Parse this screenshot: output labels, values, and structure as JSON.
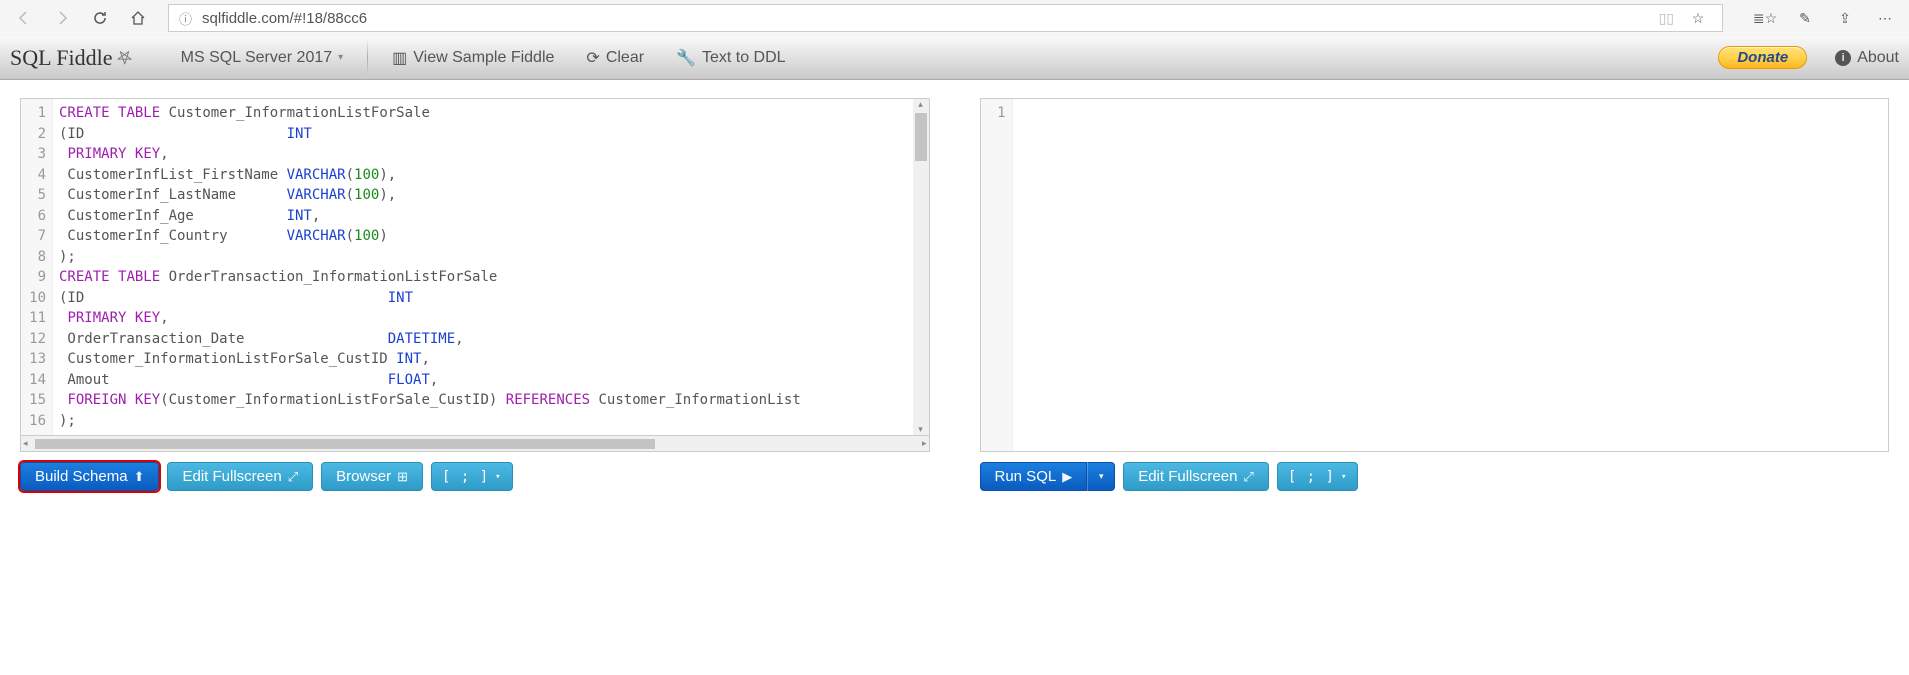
{
  "browser": {
    "url": "sqlfiddle.com/#!18/88cc6"
  },
  "brand": "SQL Fiddle",
  "db_selector": "MS SQL Server 2017",
  "nav": {
    "sample": "View Sample Fiddle",
    "clear": "Clear",
    "text_to_ddl": "Text to DDL",
    "donate": "Donate",
    "about": "About"
  },
  "left_buttons": {
    "build": "Build Schema",
    "fullscreen": "Edit Fullscreen",
    "browser": "Browser",
    "terminator": "[ ; ]"
  },
  "right_buttons": {
    "run": "Run SQL",
    "fullscreen": "Edit Fullscreen",
    "terminator": "[ ; ]"
  },
  "schema_lines": [
    {
      "n": 1,
      "tokens": [
        [
          "kw",
          "CREATE"
        ],
        [
          "pn",
          " "
        ],
        [
          "kw",
          "TABLE"
        ],
        [
          "pn",
          " Customer_InformationListForSale"
        ]
      ]
    },
    {
      "n": 2,
      "tokens": [
        [
          "pn",
          "(ID                        "
        ],
        [
          "tp",
          "INT"
        ]
      ]
    },
    {
      "n": 3,
      "tokens": [
        [
          "pn",
          " "
        ],
        [
          "kw",
          "PRIMARY"
        ],
        [
          "pn",
          " "
        ],
        [
          "kw",
          "KEY"
        ],
        [
          "pn",
          ","
        ]
      ]
    },
    {
      "n": 4,
      "tokens": [
        [
          "pn",
          " CustomerInfList_FirstName "
        ],
        [
          "tp",
          "VARCHAR"
        ],
        [
          "pn",
          "("
        ],
        [
          "num",
          "100"
        ],
        [
          "pn",
          "),"
        ]
      ]
    },
    {
      "n": 5,
      "tokens": [
        [
          "pn",
          " CustomerInf_LastName      "
        ],
        [
          "tp",
          "VARCHAR"
        ],
        [
          "pn",
          "("
        ],
        [
          "num",
          "100"
        ],
        [
          "pn",
          "),"
        ]
      ]
    },
    {
      "n": 6,
      "tokens": [
        [
          "pn",
          " CustomerInf_Age           "
        ],
        [
          "tp",
          "INT"
        ],
        [
          "pn",
          ","
        ]
      ]
    },
    {
      "n": 7,
      "tokens": [
        [
          "pn",
          " CustomerInf_Country       "
        ],
        [
          "tp",
          "VARCHAR"
        ],
        [
          "pn",
          "("
        ],
        [
          "num",
          "100"
        ],
        [
          "pn",
          ")"
        ]
      ]
    },
    {
      "n": 8,
      "tokens": [
        [
          "pn",
          ");"
        ]
      ]
    },
    {
      "n": 9,
      "tokens": [
        [
          "kw",
          "CREATE"
        ],
        [
          "pn",
          " "
        ],
        [
          "kw",
          "TABLE"
        ],
        [
          "pn",
          " OrderTransaction_InformationListForSale"
        ]
      ]
    },
    {
      "n": 10,
      "tokens": [
        [
          "pn",
          "(ID                                    "
        ],
        [
          "tp",
          "INT"
        ]
      ]
    },
    {
      "n": 11,
      "tokens": [
        [
          "pn",
          " "
        ],
        [
          "kw",
          "PRIMARY"
        ],
        [
          "pn",
          " "
        ],
        [
          "kw",
          "KEY"
        ],
        [
          "pn",
          ","
        ]
      ]
    },
    {
      "n": 12,
      "tokens": [
        [
          "pn",
          " OrderTransaction_Date                 "
        ],
        [
          "tp",
          "DATETIME"
        ],
        [
          "pn",
          ","
        ]
      ]
    },
    {
      "n": 13,
      "tokens": [
        [
          "pn",
          " Customer_InformationListForSale_CustID "
        ],
        [
          "tp",
          "INT"
        ],
        [
          "pn",
          ","
        ]
      ]
    },
    {
      "n": 14,
      "tokens": [
        [
          "pn",
          " Amout                                 "
        ],
        [
          "tp",
          "FLOAT"
        ],
        [
          "pn",
          ","
        ]
      ]
    },
    {
      "n": 15,
      "tokens": [
        [
          "pn",
          " "
        ],
        [
          "kw",
          "FOREIGN"
        ],
        [
          "pn",
          " "
        ],
        [
          "kw",
          "KEY"
        ],
        [
          "pn",
          "(Customer_InformationListForSale_CustID) "
        ],
        [
          "kw",
          "REFERENCES"
        ],
        [
          "pn",
          " Customer_InformationList"
        ]
      ]
    },
    {
      "n": 16,
      "tokens": [
        [
          "pn",
          ");"
        ]
      ]
    }
  ],
  "query_lines": [
    {
      "n": 1,
      "tokens": []
    }
  ]
}
